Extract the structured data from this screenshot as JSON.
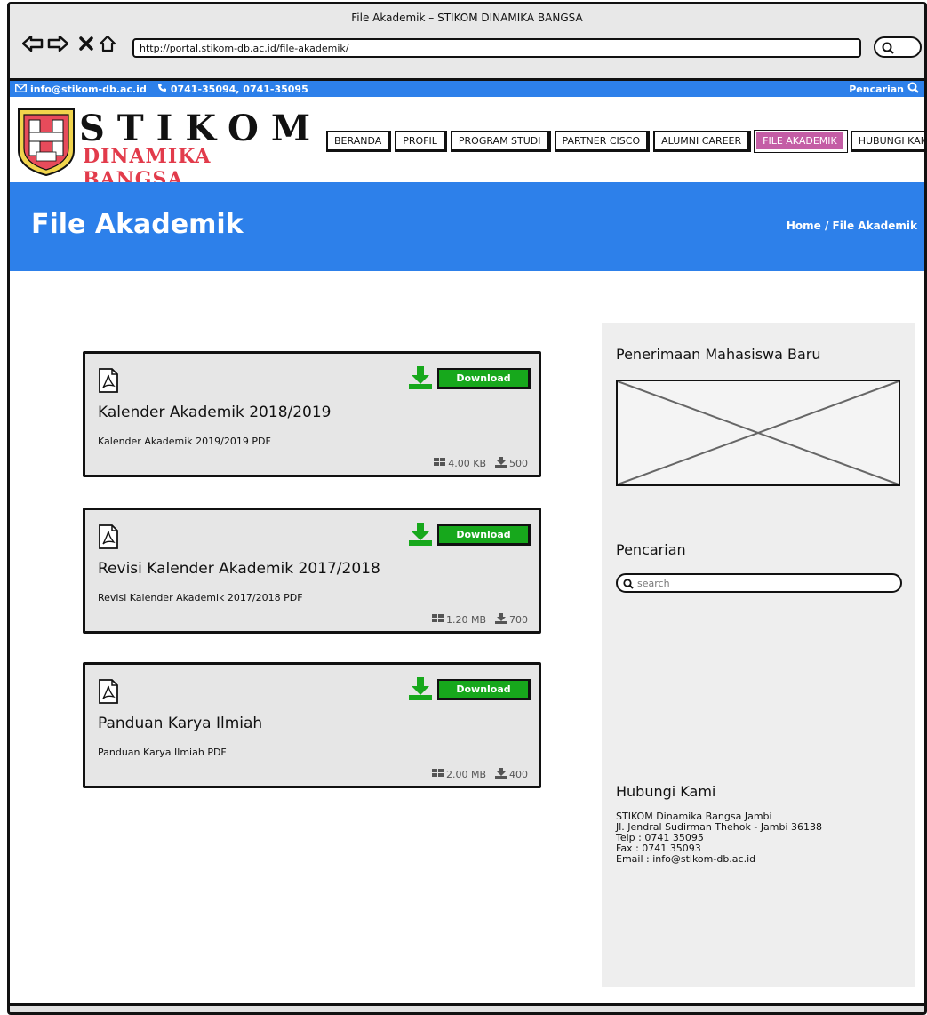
{
  "browser": {
    "window_title": "File Akademik – STIKOM DINAMIKA BANGSA",
    "url": "http://portal.stikom-db.ac.id/file-akademik/"
  },
  "topbar": {
    "email": "info@stikom-db.ac.id",
    "phone": "0741-35094, 0741-35095",
    "search_label": "Pencarian"
  },
  "logo": {
    "line1": "STIKOM",
    "line2": "DINAMIKA BANGSA"
  },
  "menu": [
    {
      "label": "BERANDA",
      "active": false
    },
    {
      "label": "PROFIL",
      "active": false
    },
    {
      "label": "PROGRAM STUDI",
      "active": false
    },
    {
      "label": "PARTNER CISCO",
      "active": false
    },
    {
      "label": "ALUMNI CAREER",
      "active": false
    },
    {
      "label": "FILE AKADEMIK",
      "active": true
    },
    {
      "label": "HUBUNGI KAMI",
      "active": false
    }
  ],
  "banner": {
    "title": "File Akademik",
    "breadcrumb": "Home / File Akademik"
  },
  "files": [
    {
      "title": "Kalender Akademik 2018/2019",
      "description": "Kalender Akademik 2019/2019 PDF",
      "size": "4.00 KB",
      "downloads": "500",
      "button": "Download"
    },
    {
      "title": "Revisi Kalender Akademik 2017/2018",
      "description": "Revisi Kalender Akademik 2017/2018 PDF",
      "size": "1.20 MB",
      "downloads": "700",
      "button": "Download"
    },
    {
      "title": "Panduan Karya Ilmiah",
      "description": "Panduan Karya Ilmiah PDF",
      "size": "2.00 MB",
      "downloads": "400",
      "button": "Download"
    }
  ],
  "sidebar": {
    "admission_heading": "Penerimaan Mahasiswa Baru",
    "search_heading": "Pencarian",
    "search_placeholder": "search",
    "contact_heading": "Hubungi Kami",
    "contact_lines": [
      "STIKOM Dinamika Bangsa Jambi",
      "Jl. Jendral Sudirman Thehok - Jambi 36138",
      "Telp : 0741 35095",
      "Fax : 0741 35093",
      "Email : info@stikom-db.ac.id"
    ]
  },
  "colors": {
    "primary": "#2d80ea",
    "active_menu": "#c45da5",
    "download": "#17a81c",
    "logo_red": "#e23b4b"
  }
}
